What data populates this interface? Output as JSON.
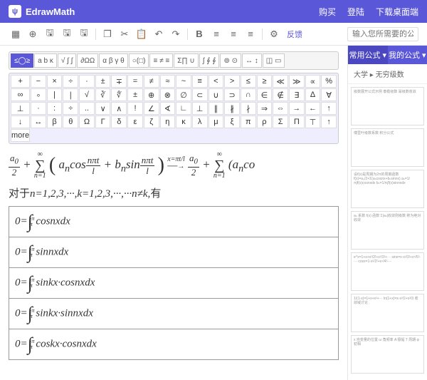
{
  "header": {
    "logo_text": "EdrawMath",
    "links": [
      "购买",
      "登陆",
      "下载桌面端"
    ]
  },
  "toolbar": {
    "feedback": "反馈",
    "search_placeholder": "输入您所需要的公式名称"
  },
  "sym_categories": [
    "≤◯≥",
    "a b κ",
    "√ ∫ ∫",
    "∂ΩΩ",
    "α β γ θ",
    "○(□)",
    "≡ ≠ ≡",
    "Σ∏ ∪",
    "∫ ∮ ∮",
    "⊚ ⊙",
    "↔ ↕",
    "◫ ▭"
  ],
  "symbols": [
    "+",
    "−",
    "×",
    "÷",
    "·",
    "±",
    "∓",
    "=",
    "≠",
    "≈",
    "~",
    "≡",
    "<",
    ">",
    "≤",
    "≥",
    "≪",
    "≫",
    "∝",
    "%",
    "∞",
    "∘",
    "|",
    "∣",
    "√",
    "∛",
    "∜",
    "±",
    "⊕",
    "⊗",
    "∅",
    "⊂",
    "∪",
    "⊃",
    "∩",
    "∈",
    "∉",
    "∃",
    "∆",
    "∀",
    "⊥",
    "·",
    ":",
    "÷",
    "..",
    "∨",
    "∧",
    "!",
    "∠",
    "∢",
    "∟",
    "⊥",
    "∥",
    "∦",
    "∤",
    "⇒",
    "⇔",
    "→",
    "←",
    "↑",
    "↓",
    "↔",
    "β",
    "θ",
    "Ω",
    "Γ",
    "δ",
    "ε",
    "ζ",
    "η",
    "κ",
    "λ",
    "μ",
    "ξ",
    "π",
    "ρ",
    "Σ",
    "Π",
    "⊤",
    "↑",
    "more"
  ],
  "content": {
    "eq1_text": "a₀/2 + Σ(aₙcos(nπt/l) + bₙsin(nπt/l)) → a₀/2 + Σ(aₙco",
    "txt_prefix": "对于",
    "txt_body": "n=1,2,3,···,k=1,2,3,···,···n≠k,",
    "txt_suffix": "有",
    "tbl": [
      {
        "int": "cos",
        "arg": "nx"
      },
      {
        "int": "sin",
        "arg": "nx"
      },
      {
        "int2a": "sin",
        "int2b": "cos",
        "arg1": "kx",
        "arg2": "nx"
      },
      {
        "int2a": "sin",
        "int2b": "sin",
        "arg1": "kx",
        "arg2": "nx"
      },
      {
        "int2a": "cos",
        "int2b": "cos",
        "arg1": "kx",
        "arg2": "nx"
      }
    ]
  },
  "sidebar": {
    "tabs": [
      "常用公式 ▾",
      "我的公式 ▾"
    ],
    "breadcrumb": "大学 ▸ 无穷级数",
    "cards": [
      "级数展开公式示例\n泰勒级数\n幂级数收敛",
      "傅里叶级数系数\n积分公式",
      "设f(x)是周期为2π的周期函数\nf(x)=a₀/2+Σ(aₙcosnx+bₙsinnx)\naₙ=1/π∫f(x)cosnxdx\nbₙ=1/π∫f(x)sinnxdx",
      "aₙ 系数\nf(x) 函数\nΣ|aₙ|收敛则级数\n称为绝对收敛",
      "e^x=1+x+x²/2!+x³/3!+···\nsinx=x-x³/3!+x⁵/5!-···\ncosx=1-x²/2!+x⁴/4!-···",
      "1/(1-x)=1+x+x²+···\nln(1+x)=x-x²/2+x³/3\n收敛域讨论",
      "x 自变量的位置\nω 角频率\nA 振幅\nT 周期\nφ 初相"
    ]
  }
}
